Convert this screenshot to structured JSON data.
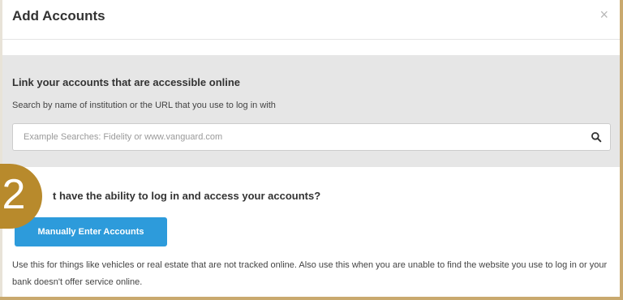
{
  "dialog": {
    "title": "Add Accounts",
    "close_glyph": "×"
  },
  "online": {
    "heading": "Link your accounts that are accessible online",
    "help": "Search by name of institution or the URL that you use to log in with",
    "search_placeholder": "Example Searches: Fidelity or www.vanguard.com",
    "search_value": "",
    "search_icon": "search-icon"
  },
  "manual": {
    "heading": "t have the ability to log in and access your accounts?",
    "button_label": "Manually Enter Accounts",
    "description": "Use this for things like vehicles or real estate that are not tracked online. Also use this when you are unable to find the website you use to log in or your bank doesn't offer service online."
  },
  "step_badge": {
    "number": "2"
  },
  "colors": {
    "accent": "#2d9bdb",
    "badge": "#b88a2c",
    "section_bg": "#e6e6e6",
    "frame": "#c9a96e"
  }
}
